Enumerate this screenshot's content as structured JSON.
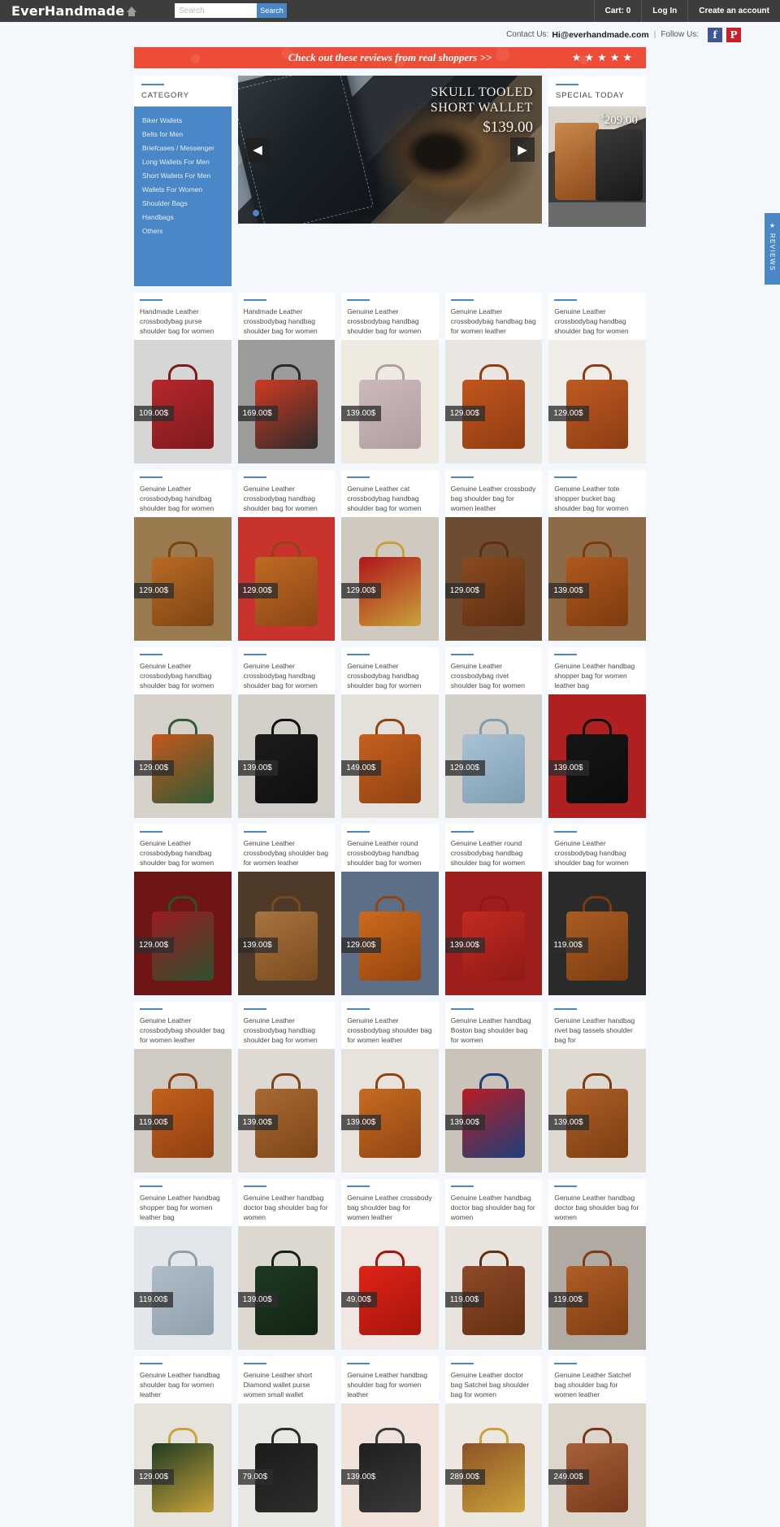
{
  "header": {
    "brand": "EverHandmade",
    "home_icon": "home-icon",
    "search_placeholder": "Search",
    "search_value": "",
    "search_button": "Search",
    "nav": [
      {
        "label": "Cart: 0",
        "name": "cart"
      },
      {
        "label": "Log In",
        "name": "login"
      },
      {
        "label": "Create an account",
        "name": "create-account"
      }
    ]
  },
  "contact": {
    "label": "Contact Us:",
    "email": "Hi@everhandmade.com",
    "separator": "|",
    "follow_label": "Follow Us:",
    "social": [
      {
        "name": "facebook-icon",
        "glyph": "f"
      },
      {
        "name": "pinterest-icon",
        "glyph": "P"
      }
    ]
  },
  "review_banner": {
    "text": "Check out these reviews from real shoppers >>",
    "stars": [
      "★",
      "★",
      "★",
      "★",
      "★"
    ],
    "bg_color": "#ed4c37"
  },
  "sidebar": {
    "title": "CATEGORY",
    "accent_color": "#4a87c7",
    "items": [
      {
        "label": "Biker Wallets"
      },
      {
        "label": "Belts for Men"
      },
      {
        "label": "Briefcases / Messenger"
      },
      {
        "label": "Long Wallets For Men"
      },
      {
        "label": "Short Wallets For Men"
      },
      {
        "label": "Wallets For Women"
      },
      {
        "label": "Shoulder Bags"
      },
      {
        "label": "Handbags"
      },
      {
        "label": "Others"
      }
    ]
  },
  "hero": {
    "line1": "SKULL TOOLED",
    "line2": "SHORT WALLET",
    "price": "$139.00",
    "prev_icon": "◀",
    "next_icon": "▶",
    "dots": 1
  },
  "special": {
    "title": "SPECIAL TODAY",
    "price_currency": "$",
    "price_value": "209.00"
  },
  "reviews_tab": {
    "star": "★",
    "label": "REVIEWS"
  },
  "products": [
    {
      "title": "Handmade Leather crossbodybag purse shoulder bag for women",
      "price": "109.00$",
      "bg": "#d6d6d6",
      "bag": "#b6272b",
      "handle": "#7d1a1d"
    },
    {
      "title": "Handmade Leather crossbodybag handbag shoulder bag for women",
      "price": "169.00$",
      "bg": "#9c9c9c",
      "bag": "#cf3a22",
      "handle": "#2b2b2b"
    },
    {
      "title": "Genuine Leather crossbodybag handbag shoulder bag for women",
      "price": "139.00$",
      "bg": "#efeadf",
      "bag": "#cbb9bb",
      "handle": "#b09ea0"
    },
    {
      "title": "Genuine Leather crossbodybag handbag bag for women leather",
      "price": "129.00$",
      "bg": "#e9e6e1",
      "bag": "#c2551d",
      "handle": "#8e3c12"
    },
    {
      "title": "Genuine Leather crossbodybag handbag shoulder bag for women",
      "price": "129.00$",
      "bg": "#f0ece7",
      "bag": "#c05a22",
      "handle": "#8b3d14"
    },
    {
      "title": "Genuine Leather crossbodybag handbag shoulder bag for women",
      "price": "129.00$",
      "bg": "#9a7b4f",
      "bag": "#b96a23",
      "handle": "#7d4413"
    },
    {
      "title": "Genuine Leather crossbodybag handbag shoulder bag for women",
      "price": "129.00$",
      "bg": "#c8332d",
      "bag": "#c06a23",
      "handle": "#8a4614"
    },
    {
      "title": "Genuine Leather cat crossbodybag handbag shoulder bag for women",
      "price": "129.00$",
      "bg": "#cfc9c0",
      "bag": "#b0151c",
      "handle": "#c8a33a"
    },
    {
      "title": "Genuine Leather crossbody bag shoulder bag for women leather",
      "price": "129.00$",
      "bg": "#6e4c31",
      "bag": "#8a4a20",
      "handle": "#5d2f10"
    },
    {
      "title": "Genuine Leather tote shopper bucket bag shoulder bag for women",
      "price": "139.00$",
      "bg": "#8d6b48",
      "bag": "#b0591d",
      "handle": "#7d3a0e"
    },
    {
      "title": "Genuine Leather crossbodybag handbag shoulder bag for women",
      "price": "129.00$",
      "bg": "#d7d2c9",
      "bag": "#c4571c",
      "handle": "#2f5a35"
    },
    {
      "title": "Genuine Leather crossbodybag handbag shoulder bag for women",
      "price": "139.00$",
      "bg": "#d2cec8",
      "bag": "#1c1c1c",
      "handle": "#0f0f0f"
    },
    {
      "title": "Genuine Leather crossbodybag handbag shoulder bag for women",
      "price": "149.00$",
      "bg": "#e4e0da",
      "bag": "#c6601f",
      "handle": "#8f4212"
    },
    {
      "title": "Genuine Leather crossbodybag rivet shoulder bag for women",
      "price": "129.00$",
      "bg": "#d3cfc9",
      "bag": "#a9c3d4",
      "handle": "#7e9cb2"
    },
    {
      "title": "Genuine Leather handbag shopper bag for women leather bag",
      "price": "139.00$",
      "bg": "#b02020",
      "bag": "#161616",
      "handle": "#0c0c0c"
    },
    {
      "title": "Genuine Leather crossbodybag handbag shoulder bag for women",
      "price": "129.00$",
      "bg": "#6e1515",
      "bag": "#9b1b20",
      "handle": "#2f5030"
    },
    {
      "title": "Genuine Leather crossbodybag shoulder bag for women leather",
      "price": "139.00$",
      "bg": "#4d3a28",
      "bag": "#a8743f",
      "handle": "#7a4a1f"
    },
    {
      "title": "Genuine Leather round crossbodybag handbag shoulder bag for women",
      "price": "129.00$",
      "bg": "#5d6f86",
      "bag": "#cd6a1e",
      "handle": "#94440f"
    },
    {
      "title": "Genuine Leather round crossbodybag handbag shoulder bag for women",
      "price": "139.00$",
      "bg": "#9e1d1d",
      "bag": "#c42a22",
      "handle": "#8d1b14"
    },
    {
      "title": "Genuine Leather crossbodybag handbag shoulder bag for women",
      "price": "119.00$",
      "bg": "#2a2a2a",
      "bag": "#ab5d23",
      "handle": "#7b3c11"
    },
    {
      "title": "Genuine Leather crossbodybag shoulder bag for women leather",
      "price": "119.00$",
      "bg": "#cfcac2",
      "bag": "#c4601d",
      "handle": "#8d3f0f"
    },
    {
      "title": "Genuine Leather crossbodybag handbag shoulder bag for women",
      "price": "139.00$",
      "bg": "#dedad3",
      "bag": "#a96a33",
      "handle": "#7c4517"
    },
    {
      "title": "Genuine Leather crossbodybag shoulder bag for women leather",
      "price": "139.00$",
      "bg": "#e7e3dc",
      "bag": "#c76b22",
      "handle": "#8f4512"
    },
    {
      "title": "Genuine Leather handbag Boston bag shoulder bag for women",
      "price": "139.00$",
      "bg": "#c9c3ba",
      "bag": "#b81d24",
      "handle": "#1d3f7a"
    },
    {
      "title": "Genuine Leather handbag rivet bag tassels shoulder bag for",
      "price": "139.00$",
      "bg": "#ded9d1",
      "bag": "#ad5f26",
      "handle": "#7d3d12"
    },
    {
      "title": "Genuine Leather handbag shopper bag for women leather bag",
      "price": "119.00$",
      "bg": "#e3e6ea",
      "bag": "#aebdc8",
      "handle": "#8fa0ad"
    },
    {
      "title": "Genuine Leather handbag doctor bag shoulder bag for women",
      "price": "139.00$",
      "bg": "#ddd8cf",
      "bag": "#1e3a21",
      "handle": "#122414"
    },
    {
      "title": "Genuine Leather crossbody bag shoulder bag for women leather",
      "price": "49.00$",
      "bg": "#f0e6e2",
      "bag": "#e02317",
      "handle": "#a5150c"
    },
    {
      "title": "Genuine Leather handbag doctor bag shoulder bag for women",
      "price": "119.00$",
      "bg": "#e8e4dd",
      "bag": "#8e4a2a",
      "handle": "#63300f"
    },
    {
      "title": "Genuine Leather handbag doctor bag shoulder bag for women",
      "price": "119.00$",
      "bg": "#b0aaa2",
      "bag": "#b05e26",
      "handle": "#7d3c11"
    },
    {
      "title": "Genuine Leather handbag shoulder bag for women leather",
      "price": "129.00$",
      "bg": "#e6e3dd",
      "bag": "#1f3b22",
      "handle": "#c9a33c"
    },
    {
      "title": "Genuine Leather short Diamond wallet purse women small wallet",
      "price": "79.00$",
      "bg": "#e9e7e3",
      "bag": "#1b1b1b",
      "handle": "#2d2d2d"
    },
    {
      "title": "Genuine Leather handbag shoulder bag for women leather",
      "price": "139.00$",
      "bg": "#f0e2da",
      "bag": "#1f1f1f",
      "handle": "#3a3a3a"
    },
    {
      "title": "Genuine Leather doctor bag Satchel bag shoulder bag for women",
      "price": "289.00$",
      "bg": "#ece8e1",
      "bag": "#8e5226",
      "handle": "#c9a33c"
    },
    {
      "title": "Genuine Leather Satchel bag shoulder bag for women leather",
      "price": "249.00$",
      "bg": "#ddd6cd",
      "bag": "#a9603a",
      "handle": "#74391a"
    }
  ]
}
